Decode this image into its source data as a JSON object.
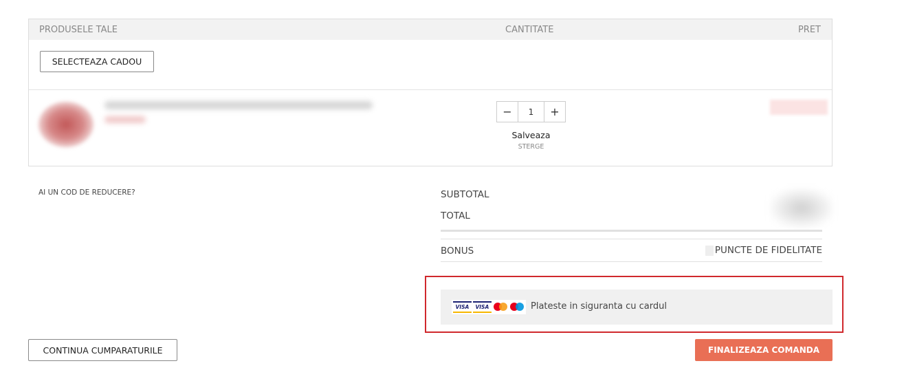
{
  "cart": {
    "headers": {
      "products": "PRODUSELE TALE",
      "quantity": "CANTITATE",
      "price": "PRET"
    },
    "gift_button": "SELECTEAZA CADOU",
    "item": {
      "quantity": "1",
      "minus": "−",
      "plus": "+",
      "save_label": "Salveaza",
      "delete_label": "STERGE"
    }
  },
  "promo": {
    "label": "AI UN COD DE REDUCERE?"
  },
  "totals": {
    "subtotal_label": "SUBTOTAL",
    "total_label": "TOTAL",
    "bonus_label": "BONUS",
    "bonus_points_label": "PUNCTE DE FIDELITATE"
  },
  "payment": {
    "card_logos": [
      "VISA",
      "VISA",
      "mastercard",
      "maestro"
    ],
    "text": "Plateste in siguranta cu cardul"
  },
  "actions": {
    "continue_label": "CONTINUA CUMPARATURILE",
    "checkout_label": "FINALIZEAZA COMANDA"
  },
  "colors": {
    "accent": "#e96f55",
    "highlight_border": "#d0282c",
    "header_bg": "#f2f2f2"
  }
}
